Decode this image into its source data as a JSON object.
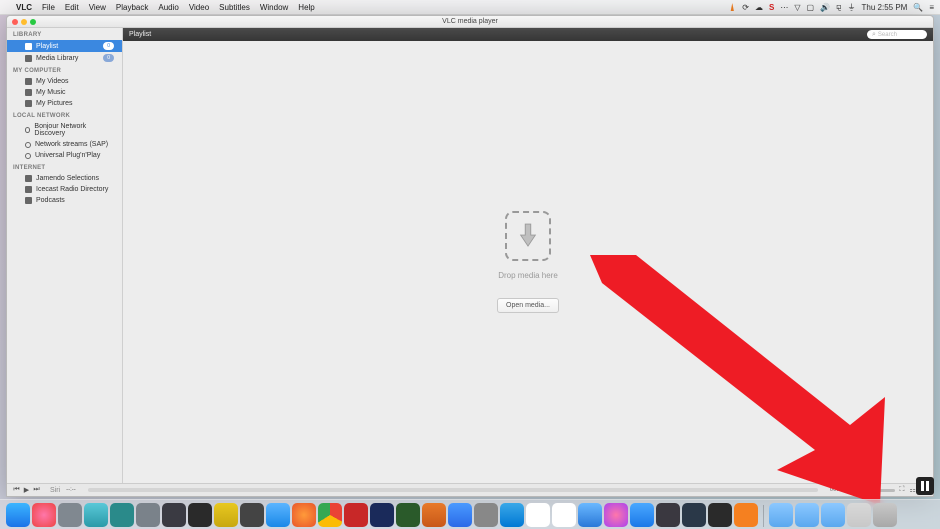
{
  "menubar": {
    "app": "VLC",
    "items": [
      "File",
      "Edit",
      "View",
      "Playback",
      "Audio",
      "Video",
      "Subtitles",
      "Window",
      "Help"
    ],
    "status_time": "Thu 2:55 PM"
  },
  "window": {
    "title": "VLC media player"
  },
  "sidebar": {
    "sections": [
      {
        "header": "LIBRARY",
        "items": [
          {
            "label": "Playlist",
            "badge": "0",
            "selected": true,
            "icon": "list"
          },
          {
            "label": "Media Library",
            "badge": "0",
            "selected": false,
            "icon": "list"
          }
        ]
      },
      {
        "header": "MY COMPUTER",
        "items": [
          {
            "label": "My Videos",
            "icon": "folder"
          },
          {
            "label": "My Music",
            "icon": "music"
          },
          {
            "label": "My Pictures",
            "icon": "photo"
          }
        ]
      },
      {
        "header": "LOCAL NETWORK",
        "items": [
          {
            "label": "Bonjour Network Discovery",
            "icon": "ring"
          },
          {
            "label": "Network streams (SAP)",
            "icon": "ring"
          },
          {
            "label": "Universal Plug'n'Play",
            "icon": "ring"
          }
        ]
      },
      {
        "header": "INTERNET",
        "items": [
          {
            "label": "Jamendo Selections",
            "icon": "globe"
          },
          {
            "label": "Icecast Radio Directory",
            "icon": "globe"
          },
          {
            "label": "Podcasts",
            "icon": "podcast"
          }
        ]
      }
    ]
  },
  "main": {
    "header_label": "Playlist",
    "search_placeholder": "Search",
    "drop_label": "Drop media here",
    "open_button": "Open media..."
  },
  "controls": {
    "siri": "Siri",
    "time_left": "--:--",
    "time_right": "00:00"
  },
  "dock_icons": [
    {
      "name": "finder",
      "bg": "linear-gradient(#3cb5ff,#1a73e8)"
    },
    {
      "name": "photos",
      "bg": "radial-gradient(circle,#f7a,#e44)"
    },
    {
      "name": "grey1",
      "bg": "#808890"
    },
    {
      "name": "skitch",
      "bg": "linear-gradient(#5ac8d8,#2a9aa8)"
    },
    {
      "name": "arduino",
      "bg": "#2a8a8a"
    },
    {
      "name": "grey2",
      "bg": "#7a828a"
    },
    {
      "name": "xcode",
      "bg": "#3a3a42"
    },
    {
      "name": "terminal",
      "bg": "#2a2a2a"
    },
    {
      "name": "keeper",
      "bg": "linear-gradient(#e8c820,#c8a810)"
    },
    {
      "name": "screenflow",
      "bg": "#444"
    },
    {
      "name": "safari",
      "bg": "linear-gradient(#5bb5ff,#1a88e8)"
    },
    {
      "name": "firefox",
      "bg": "radial-gradient(circle,#ff9a3a,#e8552a)"
    },
    {
      "name": "chrome",
      "bg": "conic-gradient(#ea4335 33%,#fbbc05 33% 66%,#34a853 66%)"
    },
    {
      "name": "filezilla",
      "bg": "#c82828"
    },
    {
      "name": "photoshop",
      "bg": "#1a2a5a"
    },
    {
      "name": "dreamweaver",
      "bg": "#2a5a2a"
    },
    {
      "name": "audacity",
      "bg": "linear-gradient(#e87a2a,#c85818)"
    },
    {
      "name": "dropbox",
      "bg": "linear-gradient(#4a9aff,#2a6ae8)"
    },
    {
      "name": "grey3",
      "bg": "#888"
    },
    {
      "name": "skype",
      "bg": "linear-gradient(#3aa8e8,#0078d4)"
    },
    {
      "name": "slack",
      "bg": "#fff"
    },
    {
      "name": "facetime",
      "bg": "#fff"
    },
    {
      "name": "mail",
      "bg": "linear-gradient(#6ab8ff,#2a78d8)"
    },
    {
      "name": "itunes",
      "bg": "radial-gradient(circle,#f7a,#a4e)"
    },
    {
      "name": "appstore",
      "bg": "linear-gradient(#4aa8ff,#1a78e8)"
    },
    {
      "name": "dark1",
      "bg": "#3a3840"
    },
    {
      "name": "steam",
      "bg": "#2a3848"
    },
    {
      "name": "obs",
      "bg": "#2a2a2a"
    },
    {
      "name": "vlc",
      "bg": "#f58020"
    },
    {
      "name": "folder1",
      "bg": "linear-gradient(#8cc8ff,#5aa8ef)"
    },
    {
      "name": "folder2",
      "bg": "linear-gradient(#8cc8ff,#5aa8ef)"
    },
    {
      "name": "folder3",
      "bg": "linear-gradient(#8cc8ff,#5aa8ef)"
    },
    {
      "name": "stack",
      "bg": "linear-gradient(#d8d8d8,#c8c8c8)"
    },
    {
      "name": "trash",
      "bg": "linear-gradient(#c8c8c8,#a8a8a8)"
    }
  ]
}
